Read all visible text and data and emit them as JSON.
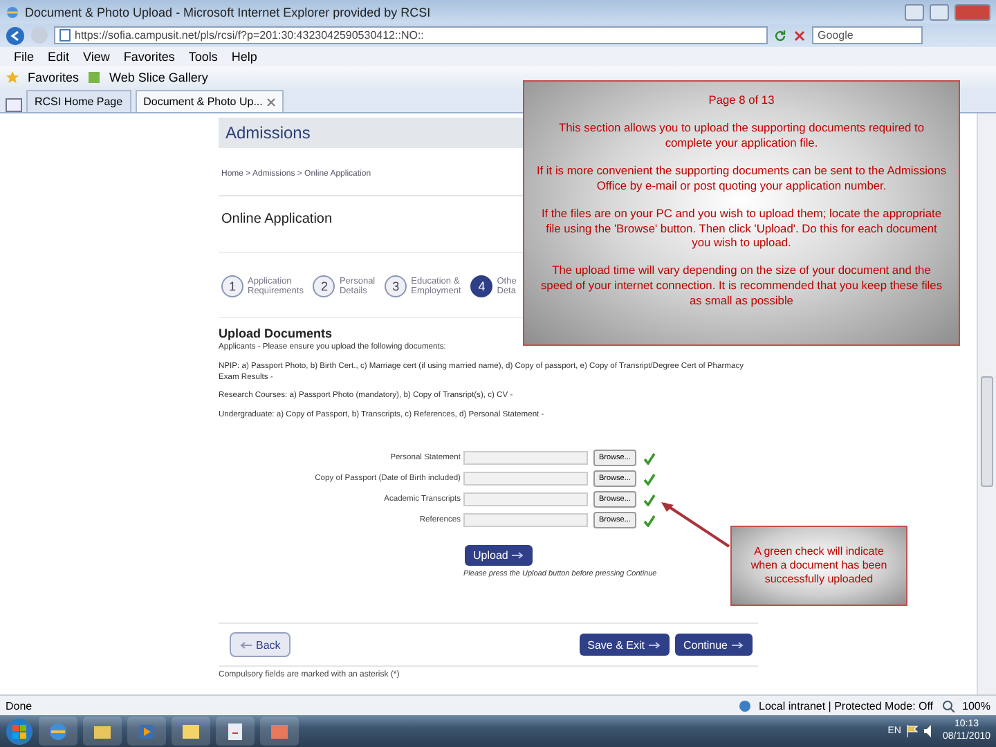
{
  "window": {
    "title": "Document & Photo Upload - Microsoft Internet Explorer provided by RCSI"
  },
  "address_bar": {
    "url": "https://sofia.campusit.net/pls/rcsi/f?p=201:30:4323042590530412::NO::"
  },
  "search": {
    "value": "Google"
  },
  "menu": [
    "File",
    "Edit",
    "View",
    "Favorites",
    "Tools",
    "Help"
  ],
  "favorites_bar": {
    "favorites": "Favorites",
    "items": [
      "Web Slice Gallery"
    ]
  },
  "tabs": [
    {
      "label": "RCSI Home Page",
      "selected": false
    },
    {
      "label": "Document & Photo Up...",
      "selected": true
    }
  ],
  "page": {
    "header": "Admissions",
    "breadcrumb": "Home > Admissions > Online Application",
    "heading": "Online Application",
    "steps": [
      {
        "number": "1",
        "lines": [
          "Application",
          "Requirements"
        ],
        "selected": false
      },
      {
        "number": "2",
        "lines": [
          "Personal",
          "Details"
        ],
        "selected": false
      },
      {
        "number": "3",
        "lines": [
          "Education &",
          "Employment"
        ],
        "selected": false
      },
      {
        "number": "4",
        "lines": [
          "Othe",
          "Deta"
        ],
        "selected": true
      }
    ],
    "section_title": "Upload Documents",
    "paragraphs": [
      "Applicants - Please ensure you upload the following documents:",
      "NPIP: a) Passport Photo, b) Birth Cert., c) Marriage cert (if using married name), d) Copy of passport, e) Copy of Transript/Degree Cert of Pharmacy Exam Results -",
      "Research Courses: a) Passport Photo (mandatory), b) Copy of Transript(s), c) CV -",
      "Undergraduate: a) Copy of Passport, b) Transcripts, c) References, d) Personal Statement -"
    ],
    "uploads": [
      {
        "label": "Personal Statement",
        "button": "Browse...",
        "uploaded": true
      },
      {
        "label": "Copy of Passport (Date of Birth included)",
        "button": "Browse...",
        "uploaded": true
      },
      {
        "label": "Academic Transcripts",
        "button": "Browse...",
        "uploaded": true
      },
      {
        "label": "References",
        "button": "Browse...",
        "uploaded": true
      }
    ],
    "upload_button": "Upload",
    "upload_note": "Please press the Upload button before pressing Continue",
    "back": "Back",
    "save_exit": "Save & Exit",
    "continue": "Continue",
    "footnote": "Compulsory fields are marked with an asterisk (*)"
  },
  "callout": {
    "page": "Page 8 of 13",
    "paragraphs": [
      "This section allows you to upload the supporting documents required to complete your application file.",
      "If it is more convenient the supporting documents can be sent to the Admissions Office by e-mail or post quoting your application number.",
      "If the files are on your PC and you wish to upload them; locate the appropriate file using the 'Browse' button. Then click 'Upload'. Do this for each document you wish to upload.",
      "The upload time will vary depending on the size of your document and the speed of your internet connection. It is recommended that you keep these files as small as possible"
    ]
  },
  "tip": {
    "text": "A green check will indicate when a document has been successfully uploaded"
  },
  "status_bar": {
    "text": "Done",
    "zone": "Local intranet | Protected Mode: Off",
    "zoom": "100%"
  },
  "taskbar": {
    "language": "EN",
    "time": "10:13",
    "date": "08/11/2010"
  }
}
